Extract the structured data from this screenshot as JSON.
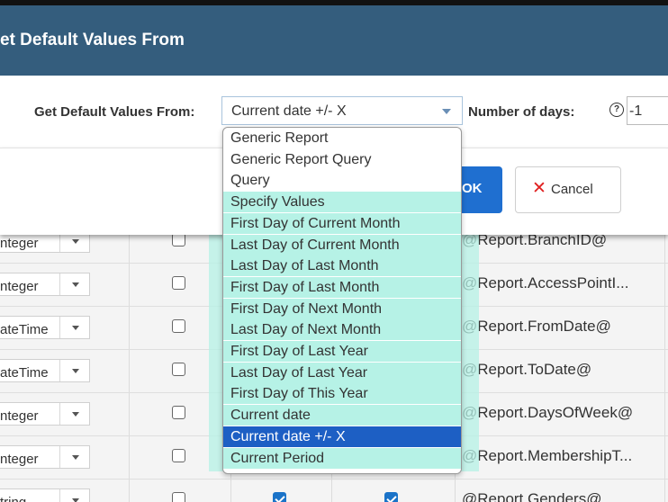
{
  "dialog": {
    "title": "et Default Values From",
    "source_label": "Get Default Values From:",
    "source_value": "Current date +/- X",
    "days_label": "Number of days:",
    "days_value": "-1",
    "ok_label": "OK",
    "cancel_label": "Cancel",
    "help_glyph": "?"
  },
  "dropdown": {
    "options": [
      "Generic Report",
      "Generic Report Query",
      "Query",
      "Specify Values",
      "First Day of Current Month",
      "Last Day of Current Month",
      "Last Day of Last Month",
      "First Day of Last Month",
      "First Day of Next Month",
      "Last Day of Next Month",
      "First Day of Last Year",
      "Last Day of Last Year",
      "First Day of This Year",
      "Current date",
      "Current date +/- X",
      "Current Period"
    ],
    "selected": "Current date +/- X"
  },
  "grid": {
    "rows": [
      {
        "type": "nteger",
        "param": "@Report.BranchID@",
        "col2": false,
        "col3": false
      },
      {
        "type": "nteger",
        "param": "@Report.AccessPointI...",
        "col2": false,
        "col3": false
      },
      {
        "type": "ateTime",
        "param": "@Report.FromDate@",
        "col2": false,
        "col3": false
      },
      {
        "type": "ateTime",
        "param": "@Report.ToDate@",
        "col2": false,
        "col3": false
      },
      {
        "type": "nteger",
        "param": "@Report.DaysOfWeek@",
        "col2": false,
        "col3": false
      },
      {
        "type": "nteger",
        "param": "@Report.MembershipT...",
        "col2": false,
        "col3": false
      },
      {
        "type": "tring",
        "param": "@Report.Genders@",
        "col2": true,
        "col3": true
      }
    ]
  },
  "colors": {
    "header": "#345d7d",
    "primary_button": "#1f6fd0",
    "selection": "#1d5fc4",
    "highlight": "#b6f2e6"
  }
}
